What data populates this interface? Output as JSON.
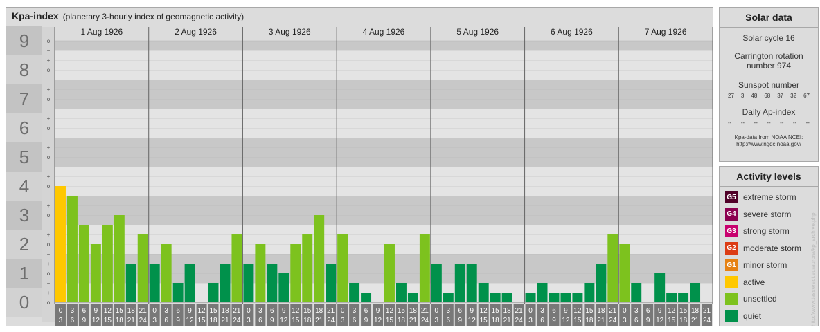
{
  "title": {
    "main": "Kpa-index",
    "sub": "(planetary 3-hourly index of geomagnetic activity)"
  },
  "chart_data": {
    "type": "bar",
    "y_major_labels": [
      "0",
      "1",
      "2",
      "3",
      "4",
      "5",
      "6",
      "7",
      "8",
      "9"
    ],
    "y_minor_labels": [
      "o",
      "+",
      "−",
      "o",
      "+",
      "−",
      "o",
      "+",
      "−",
      "o",
      "+",
      "−",
      "o",
      "+",
      "−",
      "o",
      "+",
      "−",
      "o",
      "+",
      "−",
      "o",
      "+",
      "−",
      "o",
      "+",
      "−",
      "o"
    ],
    "ylim": [
      0,
      9
    ],
    "days": [
      "1 Aug 1926",
      "2 Aug 1926",
      "3 Aug 1926",
      "4 Aug 1926",
      "5 Aug 1926",
      "6 Aug 1926",
      "7 Aug 1926"
    ],
    "interval_start": [
      "0",
      "3",
      "6",
      "9",
      "12",
      "15",
      "18",
      "21"
    ],
    "interval_end": [
      "3",
      "6",
      "9",
      "12",
      "15",
      "18",
      "21",
      "24"
    ],
    "values": [
      [
        4.0,
        3.667,
        2.667,
        2.0,
        2.667,
        3.0,
        1.333,
        2.333
      ],
      [
        1.333,
        2.0,
        0.667,
        1.333,
        0.0,
        0.667,
        1.333,
        2.333
      ],
      [
        1.333,
        2.0,
        1.333,
        1.0,
        2.0,
        2.333,
        3.0,
        1.333
      ],
      [
        2.333,
        0.667,
        0.333,
        0.0,
        2.0,
        0.667,
        0.333,
        2.333
      ],
      [
        1.333,
        0.333,
        1.333,
        1.333,
        0.667,
        0.333,
        0.333,
        0.0
      ],
      [
        0.333,
        0.667,
        0.333,
        0.333,
        0.333,
        0.667,
        1.333,
        2.333
      ],
      [
        2.0,
        0.667,
        0.0,
        1.0,
        0.333,
        0.333,
        0.667,
        0.0
      ]
    ],
    "colors": {
      "active": "#ffc800",
      "unsettled": "#7dc21e",
      "quiet": "#00914b",
      "bg_light": "#e4e4e4",
      "bg_dark": "#c8c8c8",
      "axis_box": "#787878"
    }
  },
  "solar": {
    "title": "Solar data",
    "cycle": "Solar cycle 16",
    "carrington_l1": "Carrington rotation",
    "carrington_l2": "number 974",
    "sunspot_label": "Sunspot number",
    "sunspots": [
      "27",
      "3",
      "48",
      "68",
      "37",
      "32",
      "67"
    ],
    "ap_label": "Daily Ap-index",
    "ap": [
      "--",
      "--",
      "--",
      "--",
      "--",
      "--",
      "--"
    ],
    "credit1": "Kpa-data from NOAA NCEI:",
    "credit2": "http://www.ngdc.noaa.gov/"
  },
  "levels": {
    "title": "Activity levels",
    "items": [
      {
        "code": "G5",
        "label": "extreme storm",
        "color": "#500028"
      },
      {
        "code": "G4",
        "label": "severe storm",
        "color": "#8c0050"
      },
      {
        "code": "G3",
        "label": "strong storm",
        "color": "#c8006e"
      },
      {
        "code": "G2",
        "label": "moderate storm",
        "color": "#dc3c14"
      },
      {
        "code": "G1",
        "label": "minor storm",
        "color": "#e68214"
      },
      {
        "code": "",
        "label": "active",
        "color": "#ffc800"
      },
      {
        "code": "",
        "label": "unsettled",
        "color": "#7dc21e"
      },
      {
        "code": "",
        "label": "quiet",
        "color": "#00914b"
      }
    ]
  },
  "watermark": "http://www.tesseract.eu/aurora/kp_archive.php"
}
